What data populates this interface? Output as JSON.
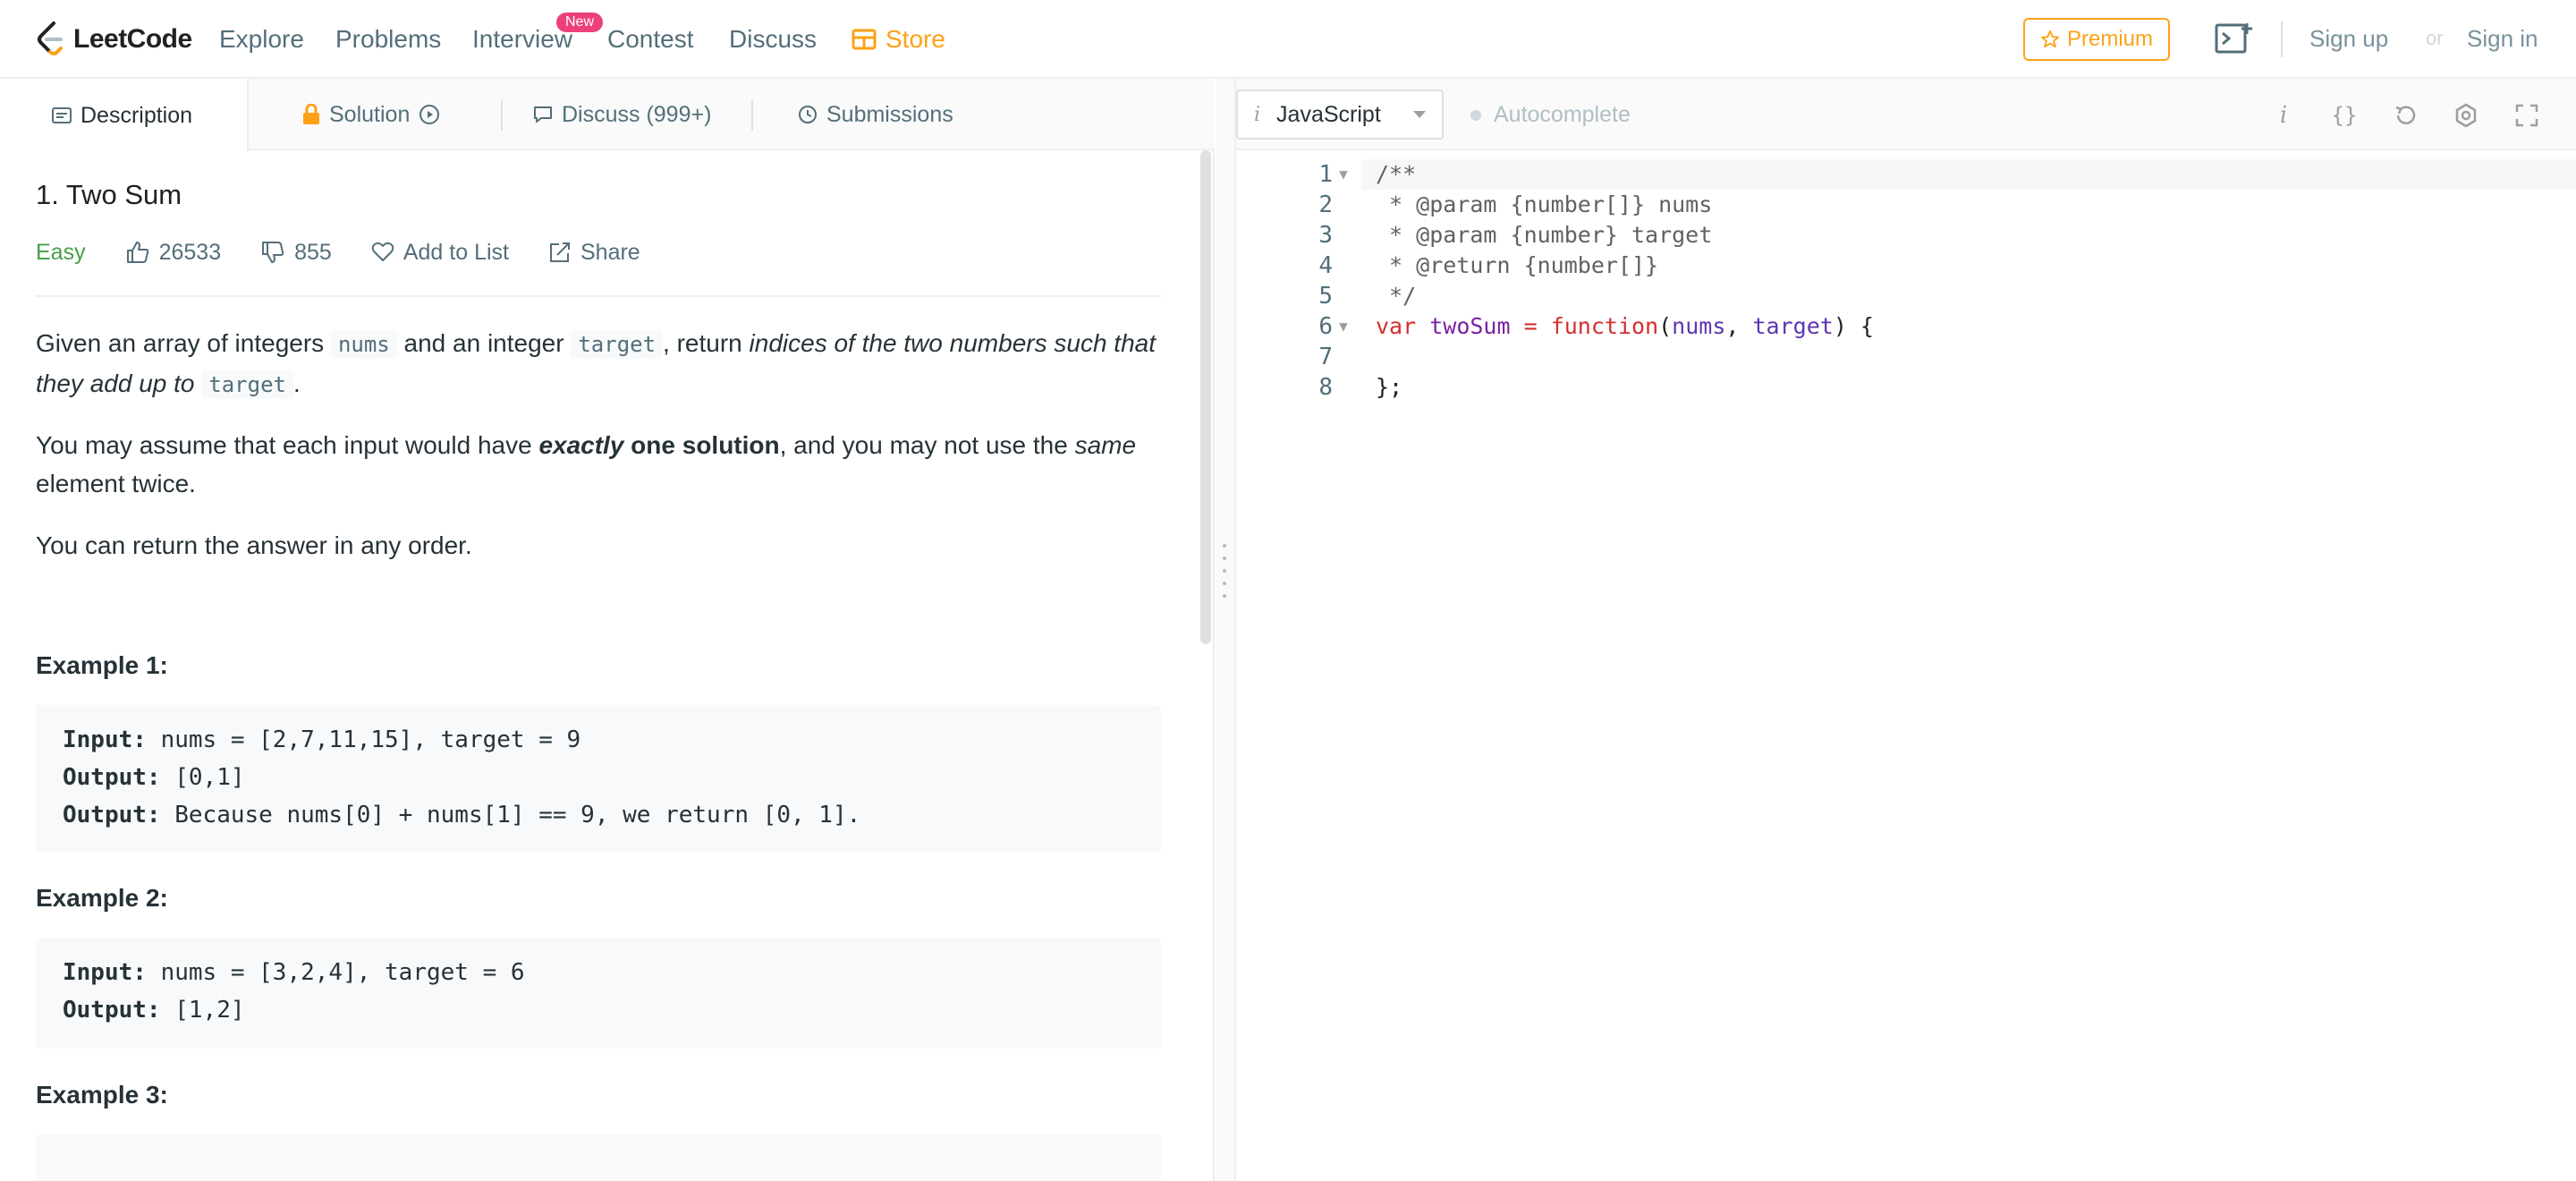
{
  "nav": {
    "brand": "LeetCode",
    "items": [
      "Explore",
      "Problems",
      "Interview",
      "Contest",
      "Discuss"
    ],
    "badge_new": "New",
    "store": "Store",
    "premium": "Premium",
    "signup": "Sign up",
    "or": "or",
    "signin": "Sign in",
    "accent_color": "#ffa116"
  },
  "tabs": {
    "description": "Description",
    "solution": "Solution",
    "discuss": "Discuss (999+)",
    "submissions": "Submissions"
  },
  "problem": {
    "title": "1. Two Sum",
    "difficulty": "Easy",
    "likes": "26533",
    "dislikes": "855",
    "add_to_list": "Add to List",
    "share": "Share",
    "p1_a": "Given an array of integers ",
    "p1_code1": "nums",
    "p1_b": " and an integer ",
    "p1_code2": "target",
    "p1_c": ", return ",
    "p1_em": "indices of the two numbers such that they add up to",
    "p1_d": " ",
    "p1_code3": "target",
    "p1_e": ".",
    "p2_a": "You may assume that each input would have ",
    "p2_bi": "exactly",
    "p2_b": " one solution",
    "p2_c": ", and you may not use the ",
    "p2_em": "same",
    "p2_d": " element twice.",
    "p3": "You can return the answer in any order.",
    "examples": [
      {
        "title": "Example 1:",
        "input_label": "Input:",
        "input": " nums = [2,7,11,15], target = 9",
        "output_label": "Output:",
        "output": " [0,1]",
        "expl_label": "Output:",
        "expl": " Because nums[0] + nums[1] == 9, we return [0, 1]."
      },
      {
        "title": "Example 2:",
        "input_label": "Input:",
        "input": " nums = [3,2,4], target = 6",
        "output_label": "Output:",
        "output": " [1,2]"
      },
      {
        "title": "Example 3:"
      }
    ]
  },
  "editor": {
    "language": "JavaScript",
    "autocomplete": "Autocomplete",
    "lines": [
      {
        "n": "1",
        "text": "/**"
      },
      {
        "n": "2",
        "text": " * @param {number[]} nums"
      },
      {
        "n": "3",
        "text": " * @param {number} target"
      },
      {
        "n": "4",
        "text": " * @return {number[]}"
      },
      {
        "n": "5",
        "text": " */"
      },
      {
        "n": "6",
        "kw1": "var",
        "fn": "twoSum",
        "eq": " = ",
        "kw2": "function",
        "p1": "(",
        "a1": "nums",
        "comma": ", ",
        "a2": "target",
        "p2": ") {"
      },
      {
        "n": "7",
        "text": ""
      },
      {
        "n": "8",
        "text": "};"
      }
    ]
  }
}
